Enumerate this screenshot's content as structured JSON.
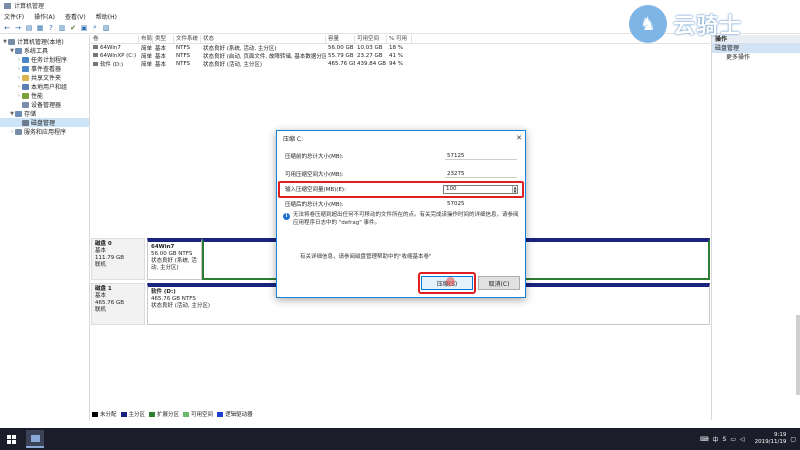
{
  "window": {
    "title": "计算机管理"
  },
  "menu": [
    "文件(F)",
    "操作(A)",
    "查看(V)",
    "帮助(H)"
  ],
  "tree": [
    {
      "label": "计算机管理(本地)",
      "indent": 0,
      "exp": "▼",
      "color": "#7a8da8"
    },
    {
      "label": "系统工具",
      "indent": 1,
      "exp": "▼",
      "color": "#6a8bb3"
    },
    {
      "label": "任务计划程序",
      "indent": 2,
      "exp": "›",
      "color": "#4a86c8"
    },
    {
      "label": "事件查看器",
      "indent": 2,
      "exp": "›",
      "color": "#4a86c8"
    },
    {
      "label": "共享文件夹",
      "indent": 2,
      "exp": "›",
      "color": "#d9b44a"
    },
    {
      "label": "本地用户和组",
      "indent": 2,
      "exp": "›",
      "color": "#5d7fb5"
    },
    {
      "label": "性能",
      "indent": 2,
      "exp": "›",
      "color": "#7aa03a"
    },
    {
      "label": "设备管理器",
      "indent": 2,
      "exp": "",
      "color": "#7a8da8"
    },
    {
      "label": "存储",
      "indent": 1,
      "exp": "▼",
      "color": "#6a8bb3"
    },
    {
      "label": "磁盘管理",
      "indent": 2,
      "exp": "",
      "color": "#6d7b8a",
      "selected": true
    },
    {
      "label": "服务和应用程序",
      "indent": 1,
      "exp": "›",
      "color": "#7a8da8"
    }
  ],
  "volumes": {
    "headers": [
      "卷",
      "布局",
      "类型",
      "文件系统",
      "状态",
      "容量",
      "可用空间",
      "% 可用"
    ],
    "rows": [
      [
        "64Win7",
        "简单",
        "基本",
        "NTFS",
        "状态良好 (系统, 活动, 主分区)",
        "56.00 GB",
        "10.03 GB",
        "18 %"
      ],
      [
        "64WinXP (C:)",
        "简单",
        "基本",
        "NTFS",
        "状态良好 (启动, 页面文件, 故障转储, 基本数据分区)",
        "55.79 GB",
        "23.27 GB",
        "41 %"
      ],
      [
        "软件 (D:)",
        "简单",
        "基本",
        "NTFS",
        "状态良好 (活动, 主分区)",
        "465.76 GB",
        "439.84 GB",
        "94 %"
      ]
    ]
  },
  "disks": [
    {
      "name": "磁盘 0",
      "type": "基本",
      "size": "111.79 GB",
      "status": "联机",
      "part_name": "64Win7",
      "part_size": "56.00 GB NTFS",
      "part_status": "状态良好 (系统, 活动, 主分区)"
    },
    {
      "name": "磁盘 1",
      "type": "基本",
      "size": "465.76 GB",
      "status": "联机",
      "part_name": "软件 (D:)",
      "part_size": "465.76 GB NTFS",
      "part_status": "状态良好 (活动, 主分区)"
    }
  ],
  "legend": [
    {
      "label": "未分配",
      "color": "#000000"
    },
    {
      "label": "主分区",
      "color": "#1a237e"
    },
    {
      "label": "扩展分区",
      "color": "#2e7d32"
    },
    {
      "label": "可用空间",
      "color": "#66bb6a"
    },
    {
      "label": "逻辑驱动器",
      "color": "#1e40d0"
    }
  ],
  "actions": {
    "header": "操作",
    "section": "磁盘管理",
    "item": "更多操作"
  },
  "watermark": {
    "text": "云骑士"
  },
  "dialog": {
    "title": "压缩 C:",
    "rows": [
      {
        "label": "压缩前的总计大小(MB):",
        "value": "57125"
      },
      {
        "label": "可用压缩空间大小(MB):",
        "value": "23275"
      },
      {
        "label": "输入压缩空间量(MB)(E):",
        "value": "100"
      },
      {
        "label": "压缩后的总计大小(MB):",
        "value": "57025"
      }
    ],
    "info": "无法将卷压缩到超出任何不可移动的文件所在的点。有关完成该操作时间的详细信息，请参阅应用程序日志中的 \"defrag\" 事件。",
    "help": "有关详细信息，请参阅磁盘管理帮助中的\"收缩基本卷\"",
    "shrink_label": "压缩(S)",
    "cancel_label": "取消(C)"
  },
  "taskbar": {
    "tray_ime": "中",
    "tray_s": "S",
    "time": "9:19",
    "date": "2019/11/19"
  }
}
